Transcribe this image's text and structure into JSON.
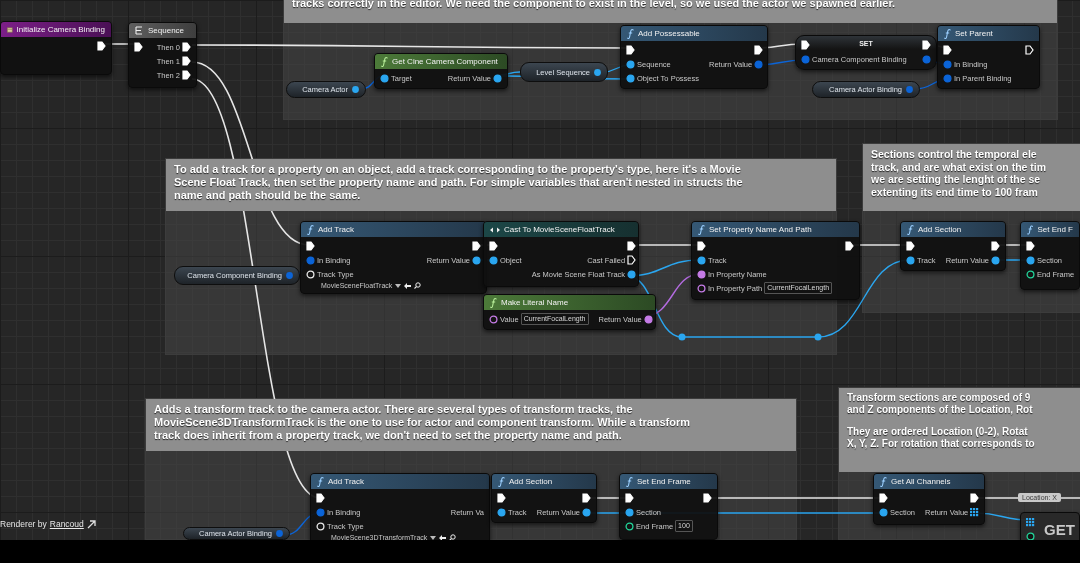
{
  "graph": {
    "comments": [
      {
        "paragraphs": [
          [
            "tracks correctly in the editor. We need the component to exist in the level, so we used the actor we spawned earlier."
          ]
        ]
      },
      {
        "paragraphs": [
          [
            "To add a track for a property on an object, add a track corresponding to the property's type, here it's a Movie",
            "Scene Float Track, then set the property name and path. For simple variables that aren't nested in structs the",
            "name and path should be the same."
          ]
        ]
      },
      {
        "paragraphs": [
          [
            "Sections control the temporal ele",
            "track, and are what exist on the tim",
            "we are setting the lenght of the se",
            "extenting its end time to 100 fram"
          ]
        ]
      },
      {
        "paragraphs": [
          [
            "Adds a transform track to the camera actor. There are several types of transform tracks, the",
            "MovieScene3DTransformTrack is the one to use for actor and component transform. While a transform",
            "track does inherit from a property track, we don't need to set the property name and path."
          ]
        ]
      },
      {
        "paragraphs": [
          [
            "Transform sections are composed of 9",
            "and Z components of the Location, Rot"
          ],
          [
            "They are ordered Location (0-2), Rotat",
            "X, Y, Z. For rotation that corresponds to"
          ]
        ]
      }
    ],
    "nodes": [
      {
        "title": "Initialize Camera Binding",
        "kind": "event",
        "outputs": [
          {
            "kind": "exec",
            "linked": true
          }
        ]
      },
      {
        "title": "Sequence",
        "kind": "sequence",
        "inputs": [
          {
            "kind": "exec",
            "linked": true
          }
        ],
        "outputs": [
          {
            "kind": "exec",
            "label": "Then 0",
            "linked": true
          },
          {
            "kind": "exec",
            "label": "Then 1",
            "linked": true
          },
          {
            "kind": "exec",
            "label": "Then 2",
            "linked": true
          }
        ]
      },
      {
        "title": "Get Cine Camera Component",
        "kind": "pure",
        "inputs": [
          {
            "kind": "object",
            "label": "Target",
            "linked": true
          }
        ],
        "outputs": [
          {
            "kind": "object",
            "label": "Return Value",
            "linked": true
          }
        ]
      },
      {
        "title": "Add Possessable",
        "kind": "function",
        "inputs": [
          {
            "kind": "exec",
            "linked": true
          },
          {
            "kind": "object",
            "label": "Sequence",
            "linked": true
          },
          {
            "kind": "object",
            "label": "Object To Possess",
            "linked": true
          }
        ],
        "outputs": [
          {
            "kind": "exec",
            "linked": true
          },
          {
            "kind": "struct",
            "label": "Return Value",
            "linked": true
          }
        ]
      },
      {
        "title": "SET",
        "kind": "set",
        "inputs": [
          {
            "kind": "exec",
            "linked": true
          },
          {
            "kind": "struct",
            "label": "Camera Component Binding",
            "linked": true
          }
        ],
        "outputs": [
          {
            "kind": "exec",
            "linked": true
          },
          {
            "kind": "struct",
            "linked": true
          }
        ]
      },
      {
        "title": "Set Parent",
        "kind": "function",
        "inputs": [
          {
            "kind": "exec",
            "linked": true
          },
          {
            "kind": "struct",
            "label": "In Binding",
            "linked": true
          },
          {
            "kind": "struct",
            "label": "In Parent Binding",
            "linked": true
          }
        ],
        "outputs": [
          {
            "kind": "exec",
            "linked": false
          }
        ]
      },
      {
        "title": "Add Track",
        "kind": "function",
        "inputs": [
          {
            "kind": "exec",
            "linked": true
          },
          {
            "kind": "struct",
            "label": "In Binding",
            "linked": true
          },
          {
            "kind": "class",
            "label": "Track Type",
            "linked": false,
            "field": {
              "kind": "dropdown",
              "value": "MovieSceneFloatTrack"
            }
          }
        ],
        "outputs": [
          {
            "kind": "exec",
            "linked": true
          },
          {
            "kind": "object",
            "label": "Return Value",
            "linked": true
          }
        ]
      },
      {
        "title": "Cast To MovieSceneFloatTrack",
        "kind": "cast",
        "inputs": [
          {
            "kind": "exec",
            "linked": true
          },
          {
            "kind": "object",
            "label": "Object",
            "linked": true
          }
        ],
        "outputs": [
          {
            "kind": "exec",
            "linked": true
          },
          {
            "kind": "exec",
            "label": "Cast Failed",
            "linked": false
          },
          {
            "kind": "object",
            "label": "As Movie Scene Float Track",
            "linked": true
          }
        ]
      },
      {
        "title": "Make Literal Name",
        "kind": "pure",
        "inputs": [
          {
            "kind": "name",
            "label": "Value",
            "linked": false,
            "field": {
              "kind": "text",
              "value": "CurrentFocalLength"
            }
          }
        ],
        "outputs": [
          {
            "kind": "name",
            "label": "Return Value",
            "linked": true
          }
        ]
      },
      {
        "title": "Set Property Name And Path",
        "kind": "function",
        "inputs": [
          {
            "kind": "exec",
            "linked": true
          },
          {
            "kind": "object",
            "label": "Track",
            "linked": true
          },
          {
            "kind": "name",
            "label": "In Property Name",
            "linked": true
          },
          {
            "kind": "name",
            "label": "In Property Path",
            "linked": false,
            "field": {
              "kind": "text",
              "value": "CurrentFocalLength"
            }
          }
        ],
        "outputs": [
          {
            "kind": "exec",
            "linked": true
          }
        ]
      },
      {
        "title": "Add Section",
        "kind": "function",
        "inputs": [
          {
            "kind": "exec",
            "linked": true
          },
          {
            "kind": "object",
            "label": "Track",
            "linked": true
          }
        ],
        "outputs": [
          {
            "kind": "exec",
            "linked": true
          },
          {
            "kind": "object",
            "label": "Return Value",
            "linked": true
          }
        ]
      },
      {
        "title": "Set End F",
        "kind": "function",
        "inputs": [
          {
            "kind": "exec",
            "linked": true
          },
          {
            "kind": "object",
            "label": "Section",
            "linked": true
          },
          {
            "kind": "int",
            "label": "End Frame",
            "linked": false
          }
        ]
      },
      {
        "title": "Add Track",
        "kind": "function",
        "inputs": [
          {
            "kind": "exec",
            "linked": true
          },
          {
            "kind": "struct",
            "label": "In Binding",
            "linked": true
          },
          {
            "kind": "class",
            "label": "Track Type",
            "linked": false,
            "field": {
              "kind": "dropdown",
              "value": "MovieScene3DTransformTrack"
            }
          }
        ],
        "outputs": [
          {
            "label": "Return Va"
          }
        ]
      },
      {
        "title": "Add Section",
        "kind": "function",
        "inputs": [
          {
            "kind": "exec",
            "linked": true
          },
          {
            "kind": "object",
            "label": "Track",
            "linked": true
          }
        ],
        "outputs": [
          {
            "kind": "exec",
            "linked": true
          },
          {
            "kind": "object",
            "label": "Return Value",
            "linked": true
          }
        ]
      },
      {
        "title": "Set End Frame",
        "kind": "function",
        "inputs": [
          {
            "kind": "exec",
            "linked": true
          },
          {
            "kind": "object",
            "label": "Section",
            "linked": true
          },
          {
            "kind": "int",
            "label": "End Frame",
            "linked": false,
            "field": {
              "kind": "text",
              "value": "100"
            }
          }
        ],
        "outputs": [
          {
            "kind": "exec",
            "linked": true
          }
        ]
      },
      {
        "title": "Get All Channels",
        "kind": "function",
        "inputs": [
          {
            "kind": "exec",
            "linked": true
          },
          {
            "kind": "object",
            "label": "Section",
            "linked": true
          }
        ],
        "outputs": [
          {
            "kind": "exec",
            "linked": true
          },
          {
            "kind": "array",
            "label": "Return Value",
            "linked": true
          }
        ]
      },
      {
        "title": "GET",
        "kind": "compact",
        "inputs": [
          {
            "kind": "array",
            "linked": true
          },
          {
            "kind": "int",
            "linked": false
          }
        ]
      }
    ],
    "variables": [
      {
        "label": "Camera Actor",
        "kind": "object"
      },
      {
        "label": "Level Sequence",
        "kind": "object"
      },
      {
        "label": "Camera Actor Binding",
        "kind": "struct"
      },
      {
        "label": "Camera Component Binding",
        "kind": "struct"
      },
      {
        "label": "Camera Actor Binding",
        "kind": "struct"
      }
    ],
    "tooltip": {
      "text": "Location: X"
    }
  },
  "credit": {
    "text": "Renderer by",
    "link": "Rancoud"
  }
}
